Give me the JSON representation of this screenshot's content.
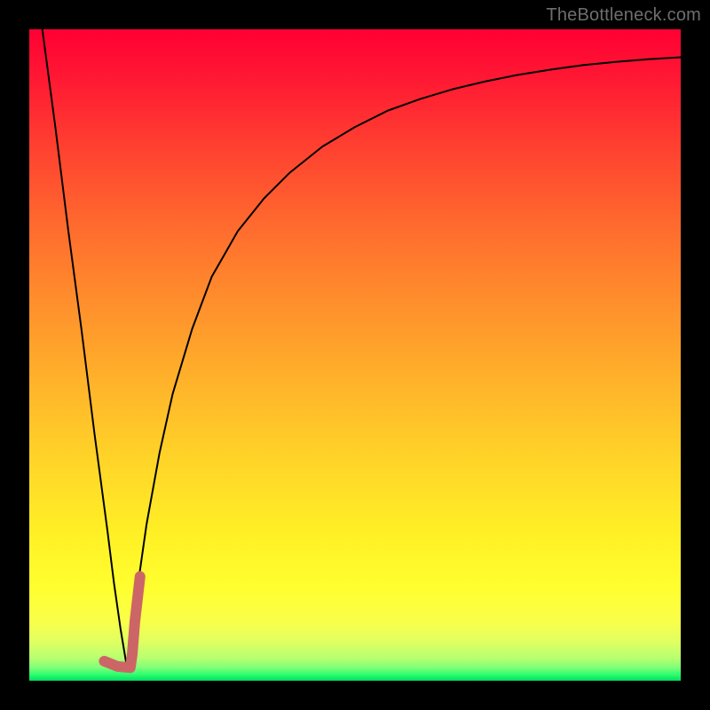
{
  "watermark": "TheBottleneck.com",
  "chart_data": {
    "type": "line",
    "title": "",
    "xlabel": "",
    "ylabel": "",
    "xlim": [
      0,
      100
    ],
    "ylim": [
      0,
      100
    ],
    "grid": false,
    "legend": false,
    "background_gradient": {
      "direction": "vertical",
      "stops": [
        {
          "pos": 0.0,
          "color": "#ff0033"
        },
        {
          "pos": 0.5,
          "color": "#ffb22a"
        },
        {
          "pos": 0.88,
          "color": "#ffff30"
        },
        {
          "pos": 1.0,
          "color": "#00e060"
        }
      ]
    },
    "series": [
      {
        "name": "bottleneck-curve",
        "color": "#000000",
        "width": 2,
        "x": [
          2,
          4,
          6,
          8,
          10,
          12,
          13,
          14,
          15,
          16,
          18,
          20,
          22,
          25,
          28,
          32,
          36,
          40,
          45,
          50,
          55,
          60,
          65,
          70,
          75,
          80,
          85,
          90,
          95,
          100
        ],
        "y": [
          100,
          85,
          69,
          54,
          38,
          23,
          15,
          8,
          2,
          10,
          24,
          35,
          44,
          54,
          62,
          69,
          74,
          78,
          82,
          85,
          87.5,
          89.3,
          90.8,
          92,
          93,
          93.8,
          94.5,
          95,
          95.4,
          95.7
        ]
      },
      {
        "name": "highlight-segment",
        "color": "#cc6666",
        "width": 12,
        "linecap": "round",
        "x": [
          11.5,
          13.5,
          15.5,
          15.8,
          16.2,
          17.0
        ],
        "y": [
          3.0,
          2.2,
          2.0,
          4.0,
          9.0,
          16.0
        ]
      }
    ]
  }
}
